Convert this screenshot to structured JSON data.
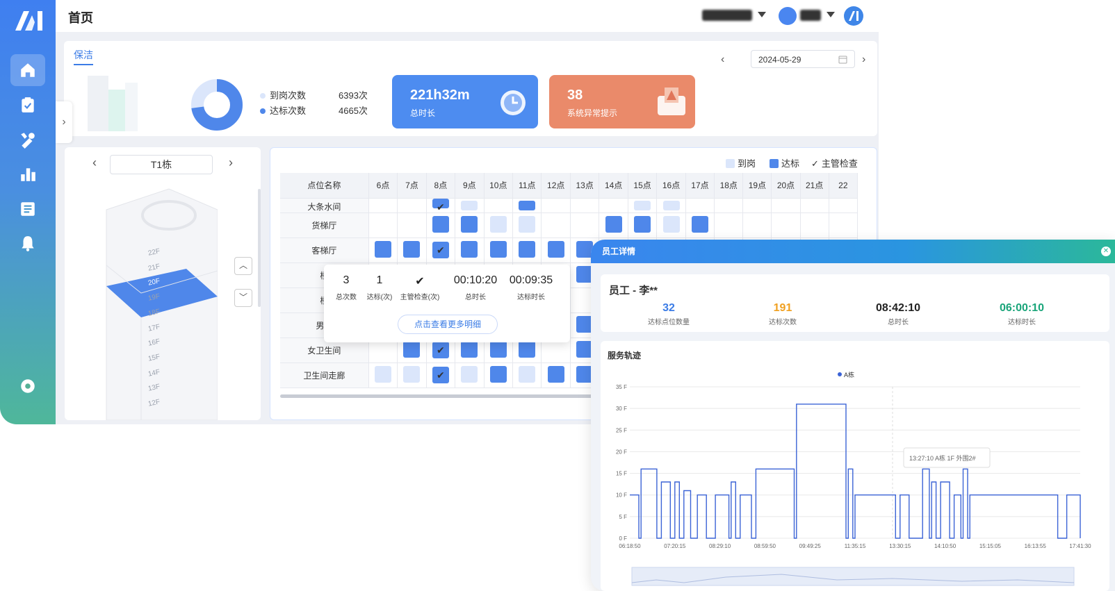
{
  "topbar": {
    "title": "首页"
  },
  "tab": {
    "label": "保洁"
  },
  "date": {
    "value": "2024-05-29"
  },
  "summary": {
    "legend": [
      {
        "label": "到岗次数",
        "value": "6393次",
        "color": "#dbe6fb"
      },
      {
        "label": "达标次数",
        "value": "4665次",
        "color": "#4f87ea"
      }
    ],
    "card_duration": {
      "value": "221h32m",
      "label": "总时长",
      "color": "#4d8cf0"
    },
    "card_alerts": {
      "value": "38",
      "label": "系统异常提示",
      "color": "#ea8a6a"
    }
  },
  "building": {
    "name": "T1栋",
    "floors": [
      "22F",
      "21F",
      "20F",
      "19F",
      "18F",
      "17F",
      "16F",
      "15F",
      "14F",
      "13F",
      "12F"
    ],
    "selected_floor": "20F"
  },
  "schedule": {
    "legend": [
      {
        "label": "到岗",
        "color": "#dbe6fb"
      },
      {
        "label": "达标",
        "color": "#4f87ea"
      },
      {
        "label": "主管检查",
        "icon": "check-icon"
      }
    ],
    "header": "点位名称",
    "hours": [
      "6点",
      "7点",
      "8点",
      "9点",
      "10点",
      "11点",
      "12点",
      "13点",
      "14点",
      "15点",
      "16点",
      "17点",
      "18点",
      "19点",
      "20点",
      "21点",
      "22"
    ],
    "rows": [
      {
        "name": "大条水间",
        "cells": [
          0,
          0,
          3,
          1,
          0,
          2,
          0,
          0,
          0,
          1,
          1,
          0,
          0,
          0,
          0,
          0,
          0
        ]
      },
      {
        "name": "货梯厅",
        "cells": [
          0,
          0,
          2,
          2,
          1,
          1,
          0,
          0,
          2,
          2,
          1,
          2,
          0,
          0,
          0,
          0,
          0
        ]
      },
      {
        "name": "客梯厅",
        "cells": [
          2,
          2,
          3,
          2,
          2,
          2,
          2,
          2,
          0,
          0,
          0,
          0,
          0,
          0,
          0,
          0,
          0
        ]
      },
      {
        "name": "楼",
        "cells": [
          0,
          0,
          0,
          0,
          0,
          0,
          0,
          2,
          0,
          0,
          0,
          0,
          0,
          0,
          0,
          0,
          0
        ]
      },
      {
        "name": "楼",
        "cells": [
          0,
          0,
          0,
          0,
          0,
          0,
          0,
          0,
          0,
          0,
          0,
          0,
          0,
          0,
          0,
          0,
          0
        ]
      },
      {
        "name": "男工",
        "cells": [
          0,
          0,
          0,
          0,
          0,
          0,
          0,
          2,
          0,
          0,
          0,
          0,
          0,
          0,
          0,
          0,
          0
        ]
      },
      {
        "name": "女卫生间",
        "cells": [
          0,
          2,
          3,
          2,
          2,
          2,
          0,
          2,
          0,
          0,
          0,
          0,
          0,
          0,
          0,
          0,
          0
        ]
      },
      {
        "name": "卫生间走廊",
        "cells": [
          1,
          1,
          3,
          1,
          2,
          1,
          2,
          2,
          0,
          0,
          0,
          0,
          0,
          0,
          0,
          0,
          0
        ]
      }
    ]
  },
  "popup": {
    "stats": [
      {
        "value": "3",
        "label": "总次数"
      },
      {
        "value": "1",
        "label": "达标(次)"
      },
      {
        "value": "✔",
        "label": "主管检查(次)"
      },
      {
        "value": "00:10:20",
        "label": "总时长"
      },
      {
        "value": "00:09:35",
        "label": "达标时长"
      }
    ],
    "button": "点击查看更多明细"
  },
  "modal": {
    "title": "员工详情",
    "employee": "员工 - 李**",
    "stats": [
      {
        "value": "32",
        "label": "达标点位数量",
        "color": "#3b7ce6"
      },
      {
        "value": "191",
        "label": "达标次数",
        "color": "#f0a020"
      },
      {
        "value": "08:42:10",
        "label": "总时长",
        "color": "#222222"
      },
      {
        "value": "06:00:10",
        "label": "达标时长",
        "color": "#1aa57a"
      }
    ],
    "chart_title": "服务轨迹",
    "tooltip": "13:27:10 A栋 1F 外围2#"
  },
  "chart_data": {
    "type": "line",
    "title": "服务轨迹",
    "series": [
      {
        "name": "A栋",
        "color": "#3b63d6"
      }
    ],
    "y_ticks": [
      "0 F",
      "5 F",
      "10 F",
      "15 F",
      "20 F",
      "25 F",
      "30 F",
      "35 F"
    ],
    "ylim": [
      0,
      35
    ],
    "x_ticks": [
      "06:18:50",
      "07:20:15",
      "08:29:10",
      "08:59:50",
      "09:49:25",
      "11:35:15",
      "13:30:15",
      "14:10:50",
      "15:15:05",
      "16:13:55",
      "17:41:30"
    ],
    "points": [
      [
        0,
        10
      ],
      [
        0.02,
        10
      ],
      [
        0.02,
        0
      ],
      [
        0.025,
        0
      ],
      [
        0.025,
        16
      ],
      [
        0.06,
        16
      ],
      [
        0.06,
        0
      ],
      [
        0.07,
        0
      ],
      [
        0.07,
        13
      ],
      [
        0.09,
        13
      ],
      [
        0.09,
        0
      ],
      [
        0.1,
        0
      ],
      [
        0.1,
        13
      ],
      [
        0.11,
        13
      ],
      [
        0.11,
        0
      ],
      [
        0.12,
        0
      ],
      [
        0.12,
        11
      ],
      [
        0.135,
        11
      ],
      [
        0.135,
        0
      ],
      [
        0.15,
        0
      ],
      [
        0.15,
        10
      ],
      [
        0.17,
        10
      ],
      [
        0.17,
        0
      ],
      [
        0.19,
        0
      ],
      [
        0.19,
        10
      ],
      [
        0.22,
        10
      ],
      [
        0.22,
        0
      ],
      [
        0.225,
        0
      ],
      [
        0.225,
        13
      ],
      [
        0.235,
        13
      ],
      [
        0.235,
        0
      ],
      [
        0.245,
        0
      ],
      [
        0.245,
        10
      ],
      [
        0.27,
        10
      ],
      [
        0.27,
        0
      ],
      [
        0.28,
        0
      ],
      [
        0.28,
        16
      ],
      [
        0.365,
        16
      ],
      [
        0.365,
        0
      ],
      [
        0.37,
        0
      ],
      [
        0.37,
        31
      ],
      [
        0.48,
        31
      ],
      [
        0.48,
        0
      ],
      [
        0.485,
        0
      ],
      [
        0.485,
        16
      ],
      [
        0.495,
        16
      ],
      [
        0.495,
        0
      ],
      [
        0.5,
        0
      ],
      [
        0.5,
        10
      ],
      [
        0.59,
        10
      ],
      [
        0.59,
        0
      ],
      [
        0.6,
        0
      ],
      [
        0.6,
        10
      ],
      [
        0.62,
        10
      ],
      [
        0.62,
        0
      ],
      [
        0.65,
        0
      ],
      [
        0.65,
        16
      ],
      [
        0.665,
        16
      ],
      [
        0.665,
        0
      ],
      [
        0.67,
        0
      ],
      [
        0.67,
        13
      ],
      [
        0.68,
        13
      ],
      [
        0.68,
        0
      ],
      [
        0.69,
        0
      ],
      [
        0.69,
        13
      ],
      [
        0.71,
        13
      ],
      [
        0.71,
        0
      ],
      [
        0.72,
        0
      ],
      [
        0.72,
        10
      ],
      [
        0.735,
        10
      ],
      [
        0.735,
        0
      ],
      [
        0.74,
        0
      ],
      [
        0.74,
        16
      ],
      [
        0.75,
        16
      ],
      [
        0.75,
        0
      ],
      [
        0.755,
        0
      ],
      [
        0.755,
        10
      ],
      [
        0.95,
        10
      ],
      [
        0.95,
        0
      ],
      [
        0.97,
        0
      ],
      [
        0.97,
        10
      ],
      [
        1,
        10
      ],
      [
        1,
        0
      ]
    ]
  }
}
